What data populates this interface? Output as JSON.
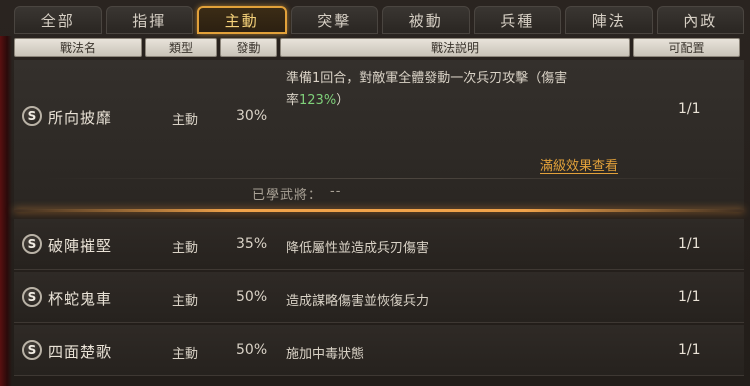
{
  "tabs": [
    {
      "label": "全部"
    },
    {
      "label": "指揮"
    },
    {
      "label": "主動"
    },
    {
      "label": "突擊"
    },
    {
      "label": "被動"
    },
    {
      "label": "兵種"
    },
    {
      "label": "陣法"
    },
    {
      "label": "內政"
    }
  ],
  "active_tab": "主動",
  "columns": {
    "name": "戰法名",
    "type": "類型",
    "trigger": "發動",
    "desc": "戰法説明",
    "config": "可配置"
  },
  "tactics": [
    {
      "badge": "S",
      "name": "所向披靡",
      "type": "主動",
      "trigger": "30%",
      "desc_pre": "準備1回合，對敵軍全體發動一次兵刃攻擊（傷害",
      "desc_line2_pre": "率",
      "desc_value": "123%",
      "desc_post": "）",
      "config": "1/1",
      "link": "滿級效果查看",
      "learned_label": "已學武將：",
      "learned_value": "--"
    },
    {
      "badge": "S",
      "name": "破陣摧堅",
      "type": "主動",
      "trigger": "35%",
      "desc": "降低屬性並造成兵刃傷害",
      "config": "1/1"
    },
    {
      "badge": "S",
      "name": "杯蛇鬼車",
      "type": "主動",
      "trigger": "50%",
      "desc": "造成謀略傷害並恢復兵力",
      "config": "1/1"
    },
    {
      "badge": "S",
      "name": "四面楚歌",
      "type": "主動",
      "trigger": "50%",
      "desc": "施加中毒狀態",
      "config": "1/1"
    }
  ],
  "colors": {
    "accent": "#e2a13a",
    "highlight_value": "#7fd07a",
    "text": "#e9e2d6"
  }
}
